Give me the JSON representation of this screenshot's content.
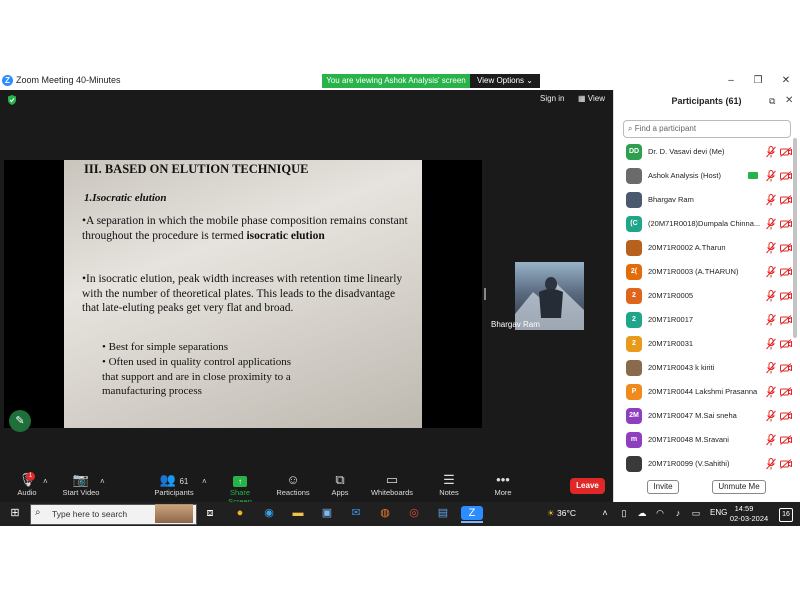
{
  "window": {
    "title": "Zoom Meeting 40-Minutes",
    "share_banner": "You are viewing Ashok Analysis' screen",
    "view_options": "View Options"
  },
  "meeting_header": {
    "sign_in": "Sign in",
    "view": "View"
  },
  "slide": {
    "heading": "III. BASED ON ELUTION TECHNIQUE",
    "subheading": "1.Isocratic elution",
    "p1_text": "•A separation in which the mobile phase composition remains constant throughout the procedure is termed ",
    "p1_bold": "isocratic elution",
    "p2": "•In isocratic elution, peak width increases with retention time linearly with the number of theoretical plates. This leads to the disadvantage that late-eluting peaks get very flat and broad.",
    "bullet1": "• Best for simple separations",
    "bullet2": "• Often used in quality control applications that support and are in close proximity to a manufacturing process"
  },
  "video_thumb": {
    "name": "Bhargav Ram"
  },
  "toolbar": {
    "audio": "Audio",
    "start_video": "Start Video",
    "participants": "Participants",
    "participants_count": "61",
    "share_screen": "Share Screen",
    "reactions": "Reactions",
    "apps": "Apps",
    "whiteboards": "Whiteboards",
    "notes": "Notes",
    "more": "More",
    "leave": "Leave",
    "audio_badge": "1"
  },
  "participants_panel": {
    "title": "Participants (61)",
    "search_placeholder": "Find a participant",
    "invite": "Invite",
    "unmute_me": "Unmute Me",
    "items": [
      {
        "initials": "DD",
        "name": "Dr. D. Vasavi devi (Me)",
        "color": "#2E9E4F"
      },
      {
        "initials": "",
        "name": "Ashok Analysis (Host)",
        "color": "#6b6b6b"
      },
      {
        "initials": "",
        "name": "Bhargav Ram",
        "color": "#4a5a6e"
      },
      {
        "initials": "(C",
        "name": "(20M71R0018)Dumpala Chinna...",
        "color": "#1FA58A"
      },
      {
        "initials": "",
        "name": "20M71R0002 A.Tharun",
        "color": "#B8611E"
      },
      {
        "initials": "2(",
        "name": "20M71R0003 (A.THARUN)",
        "color": "#E36C0A"
      },
      {
        "initials": "2",
        "name": "20M71R0005",
        "color": "#E0651C"
      },
      {
        "initials": "2",
        "name": "20M71R0017",
        "color": "#1FA58A"
      },
      {
        "initials": "2",
        "name": "20M71R0031",
        "color": "#E89B1A"
      },
      {
        "initials": "",
        "name": "20M71R0043 k kiriti",
        "color": "#8a6a4a"
      },
      {
        "initials": "P",
        "name": "20M71R0044 Lakshmi Prasanna",
        "color": "#F08A1C"
      },
      {
        "initials": "2M",
        "name": "20M71R0047 M.Sai sneha",
        "color": "#8E3FBF"
      },
      {
        "initials": "m",
        "name": "20M71R0048 M.Sravani",
        "color": "#8E3FBF"
      },
      {
        "initials": "",
        "name": "20M71R0099 (V.Sahithi)",
        "color": "#3a3a3a"
      }
    ]
  },
  "taskbar": {
    "search_placeholder": "Type here to search",
    "weather": "36°C",
    "lang": "ENG",
    "time": "14:59",
    "date": "02-03-2024",
    "notification_count": "16"
  }
}
